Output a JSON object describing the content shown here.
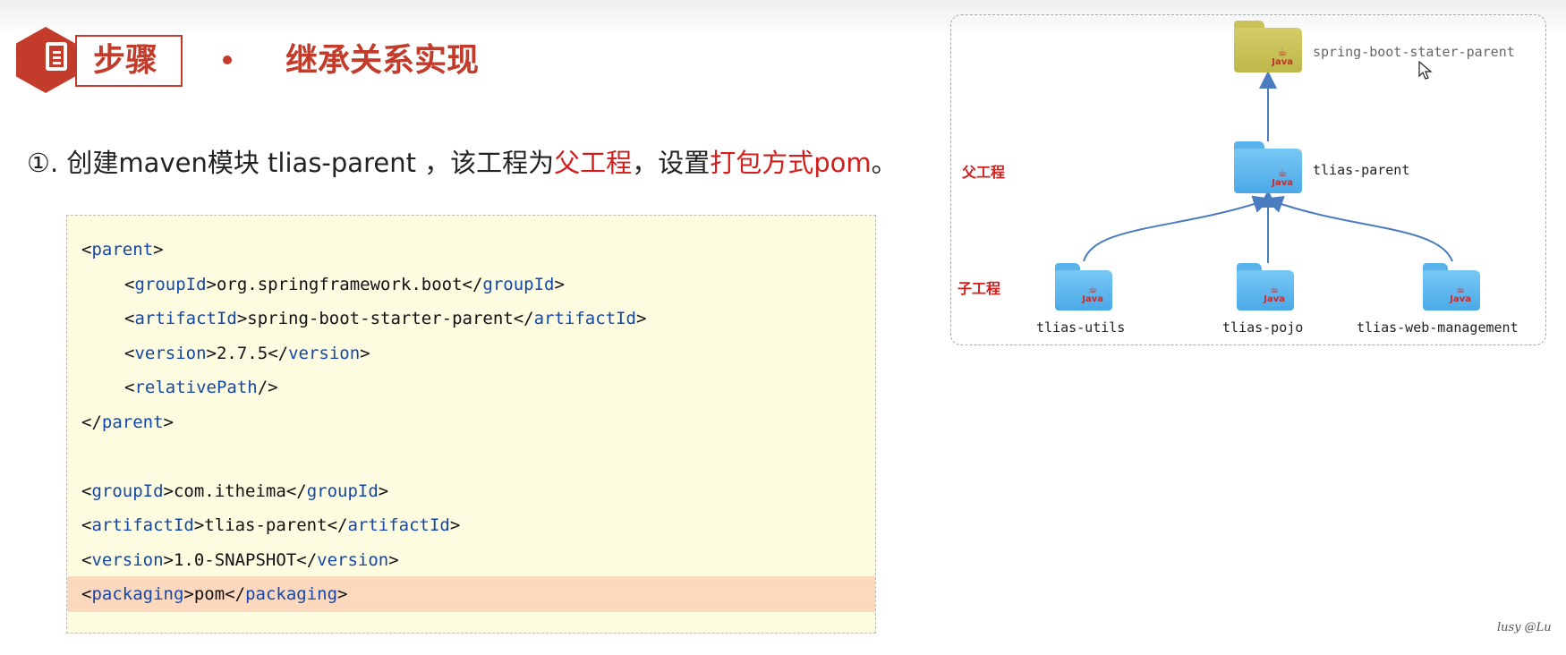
{
  "header": {
    "step_label": "步骤",
    "title": "继承关系实现"
  },
  "step": {
    "prefix": "①. 创建maven模块 tlias-parent ，该工程为",
    "highlight1": "父工程",
    "middle": "，设置",
    "highlight2": "打包方式pom",
    "suffix": "。"
  },
  "code": {
    "lines": [
      {
        "indent": "",
        "open": "<parent>",
        "text": "",
        "close": ""
      },
      {
        "indent": "    ",
        "open": "<groupId>",
        "text": "org.springframework.boot",
        "close": "</groupId>"
      },
      {
        "indent": "    ",
        "open": "<artifactId>",
        "text": "spring-boot-starter-parent",
        "close": "</artifactId>"
      },
      {
        "indent": "    ",
        "open": "<version>",
        "text": "2.7.5",
        "close": "</version>"
      },
      {
        "indent": "    ",
        "open": "<relativePath/>",
        "text": "",
        "close": ""
      },
      {
        "indent": "",
        "open": "</parent>",
        "text": "",
        "close": ""
      },
      {
        "indent": "",
        "open": "",
        "text": "",
        "close": ""
      },
      {
        "indent": "",
        "open": "<groupId>",
        "text": "com.itheima",
        "close": "</groupId>"
      },
      {
        "indent": "",
        "open": "<artifactId>",
        "text": "tlias-parent",
        "close": "</artifactId>"
      },
      {
        "indent": "",
        "open": "<version>",
        "text": "1.0-SNAPSHOT",
        "close": "</version>"
      },
      {
        "indent": "",
        "open": "<packaging>",
        "text": "pom",
        "close": "</packaging>"
      }
    ],
    "highlighted_line": 10
  },
  "diagram": {
    "label_parent": "父工程",
    "label_child": "子工程",
    "root": "spring-boot-stater-parent",
    "parent": "tlias-parent",
    "children": [
      "tlias-utils",
      "tlias-pojo",
      "tlias-web-management"
    ],
    "java_label": "Java"
  },
  "watermark": "lusy @Lu"
}
